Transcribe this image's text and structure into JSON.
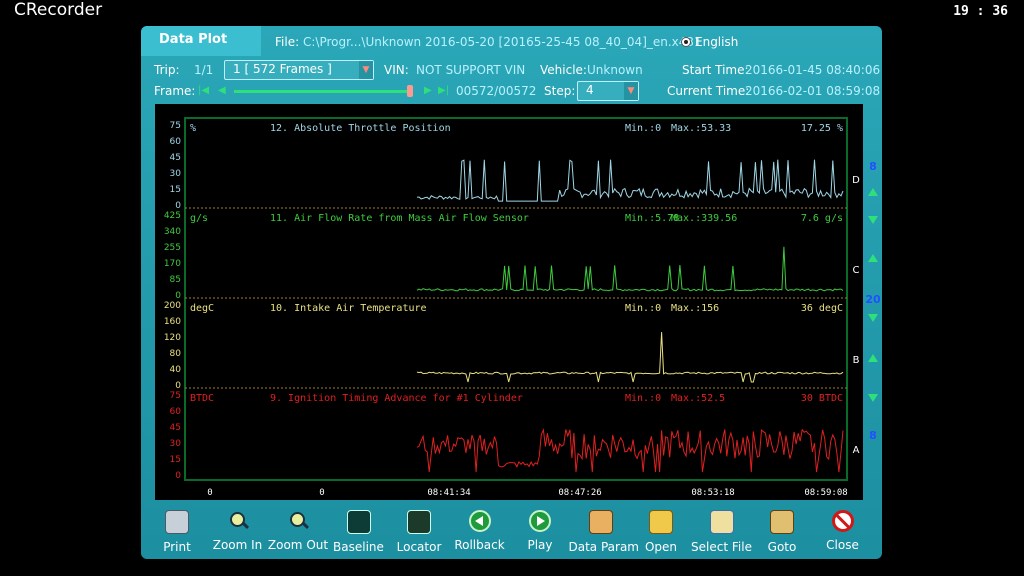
{
  "app": {
    "title": "CRecorder",
    "clock": "19 : 36"
  },
  "header": {
    "title": "Data Plot",
    "file_label": "File:",
    "file_value": "C:\\Progr...\\Unknown 2016-05-20 [20165-25-45 08_40_04]_en.x431",
    "language": "English"
  },
  "info": {
    "trip_label": "Trip:",
    "trip_value": "1/1",
    "trip_select": "1  [   572 Frames ]",
    "vin_label": "VIN:",
    "vin_value": "NOT SUPPORT VIN",
    "vehicle_label": "Vehicle:",
    "vehicle_value": "Unknown",
    "start_label": "Start Time:",
    "start_value": "20166-01-45 08:40:06",
    "frame_label": "Frame:",
    "frame_value": "00572/00572",
    "step_label": "Step:",
    "step_value": "4",
    "current_label": "Current Time:",
    "current_value": "20166-02-01 08:59:08",
    "frame_progress": 1.0
  },
  "chart_data": [
    {
      "type": "line",
      "unit": "%",
      "title": "12. Absolute Throttle Position",
      "min": "Min.:0",
      "max": "Max.:53.33",
      "current": "17.25  %",
      "yticks": [
        "75",
        "60",
        "45",
        "30",
        "15",
        "0"
      ],
      "ylim": [
        0,
        75
      ],
      "color": "#9fd6e6",
      "channel": "D",
      "values": [
        0,
        0,
        0,
        0,
        0,
        0,
        0,
        0,
        0,
        0,
        0,
        0,
        0,
        0,
        0,
        0,
        0,
        0,
        0,
        0,
        0,
        0,
        0,
        0,
        0,
        0,
        0,
        0,
        0,
        0,
        0,
        0,
        0,
        0,
        0,
        0,
        0,
        0,
        0,
        0,
        0,
        0,
        0,
        0,
        0,
        0,
        0,
        0,
        0,
        0,
        0,
        0,
        0,
        0,
        0,
        0,
        0,
        0,
        0,
        0,
        0,
        0,
        0,
        0,
        0,
        0,
        0,
        0,
        0,
        0,
        0,
        0,
        0,
        0,
        0,
        0,
        0,
        0,
        0,
        0,
        0,
        0,
        0,
        0,
        0,
        0,
        0,
        0,
        0,
        0,
        0,
        0,
        0,
        0,
        0,
        0,
        0,
        0,
        0,
        0,
        0,
        0,
        0,
        0,
        0,
        0,
        0,
        0,
        0,
        0,
        0,
        0,
        0,
        0,
        0,
        0,
        0,
        0,
        0,
        0,
        0,
        0,
        0,
        0,
        0,
        0,
        0,
        0,
        0,
        0,
        0,
        0,
        0,
        0,
        0,
        0,
        0,
        0,
        0,
        0,
        0,
        0,
        0,
        0,
        0,
        0,
        0,
        0,
        0,
        0,
        0,
        0,
        0,
        0,
        0,
        0,
        0,
        0,
        0,
        0,
        0,
        0,
        0,
        0,
        0,
        0,
        0,
        0,
        0,
        0,
        0,
        0,
        0,
        0,
        0,
        0,
        0,
        0,
        0,
        0,
        0,
        0,
        0,
        0,
        0,
        0,
        0,
        0,
        0,
        0,
        0,
        0,
        0,
        0,
        0,
        0,
        0,
        0,
        0,
        0,
        0,
        0,
        0,
        0,
        0,
        0,
        0,
        0,
        0,
        0,
        0,
        0,
        0,
        0,
        0,
        0,
        0,
        0,
        0,
        0,
        0,
        0,
        0,
        0,
        0,
        0,
        0,
        0,
        0,
        0,
        0,
        0,
        0,
        0,
        0,
        0,
        0,
        0,
        0,
        0,
        0,
        0,
        0,
        0,
        0,
        0,
        0,
        0,
        0,
        0,
        0,
        0,
        0,
        0,
        0,
        0,
        0,
        0,
        0,
        0,
        0,
        0,
        0,
        0,
        0,
        0,
        0,
        0,
        0,
        0,
        0,
        0,
        0,
        0,
        0,
        0,
        0,
        0,
        0,
        0,
        0,
        0,
        0,
        0,
        0,
        0,
        0,
        0,
        0,
        0,
        0,
        0,
        0,
        0,
        0,
        0,
        0,
        0,
        0,
        0,
        0,
        0,
        0,
        0,
        0,
        0,
        0,
        0,
        0,
        0,
        0,
        0,
        0,
        0,
        0,
        0,
        0,
        0,
        0,
        0,
        0,
        0,
        0,
        0,
        0,
        0,
        0,
        0,
        0,
        0,
        0,
        0,
        0,
        0,
        0,
        0,
        0,
        0,
        0,
        0,
        0,
        0,
        0,
        0,
        0,
        0,
        0,
        0,
        0,
        0,
        0,
        0,
        0,
        0,
        0,
        0,
        0,
        0,
        0,
        0,
        0,
        0,
        0,
        0,
        0,
        0,
        0,
        0,
        0,
        0,
        0,
        0,
        0,
        0,
        0,
        0,
        0,
        0,
        0,
        0,
        0,
        0,
        0,
        0,
        0,
        0,
        0,
        0,
        0,
        0,
        0,
        0,
        0,
        0,
        0,
        0,
        0,
        0,
        0,
        0,
        0,
        0,
        0,
        0,
        0,
        0,
        0,
        0,
        0,
        0,
        0,
        0,
        0,
        0,
        0,
        0,
        0,
        0,
        0,
        0,
        0,
        0,
        0,
        0,
        0,
        0,
        0,
        0,
        0,
        0,
        0,
        0,
        0,
        0,
        0,
        0,
        0,
        0,
        0,
        0,
        0,
        0,
        0,
        0,
        0,
        0,
        0,
        0,
        0,
        0,
        0,
        0,
        0,
        0,
        0,
        0,
        0,
        0,
        0,
        0,
        0,
        0,
        0,
        0,
        0,
        0,
        0,
        0,
        0,
        0,
        0,
        0,
        0,
        0,
        0,
        0,
        0,
        0,
        0,
        0,
        0,
        0,
        0,
        0,
        0,
        0,
        0,
        0,
        0,
        0,
        0,
        0,
        0,
        0,
        0,
        0,
        0,
        0,
        0,
        0,
        0,
        0,
        0,
        0,
        0,
        0,
        0,
        0,
        0,
        0,
        0,
        0,
        0,
        0,
        0,
        0,
        0,
        0,
        0,
        0,
        0,
        0,
        0,
        0,
        0,
        0,
        0,
        0,
        0,
        0,
        0,
        0,
        0,
        0,
        0,
        0,
        0,
        0,
        0,
        0,
        0,
        0,
        0,
        0,
        0,
        0,
        0,
        0,
        0,
        0,
        0,
        0,
        0,
        0,
        0,
        0,
        0,
        0,
        0,
        0,
        0,
        0,
        0,
        0,
        0,
        0,
        0,
        0,
        0,
        0,
        0,
        0,
        0,
        0,
        0,
        0,
        0,
        0,
        0,
        0,
        0,
        0,
        0,
        0,
        0,
        0,
        0,
        0,
        0,
        0,
        0,
        0,
        0,
        0,
        0,
        0,
        0,
        0,
        0,
        0,
        0,
        0,
        0,
        0,
        0,
        0,
        0,
        0,
        0,
        0,
        0,
        0
      ]
    },
    {
      "type": "line",
      "unit": "g/s",
      "title": "11. Air Flow Rate from Mass Air Flow Sensor",
      "min": "Min.:5.78",
      "max": "Max.:339.56",
      "current": "7.6  g/s",
      "yticks": [
        "425",
        "340",
        "255",
        "170",
        "85",
        "0"
      ],
      "ylim": [
        0,
        425
      ],
      "color": "#3ecb3e",
      "channel": "C",
      "values": []
    },
    {
      "type": "line",
      "unit": "degC",
      "title": "10. Intake Air Temperature",
      "min": "Min.:0",
      "max": "Max.:156",
      "current": "36  degC",
      "yticks": [
        "200",
        "160",
        "120",
        "80",
        "40",
        "0"
      ],
      "ylim": [
        0,
        200
      ],
      "color": "#e8e080",
      "channel": "B",
      "values": []
    },
    {
      "type": "line",
      "unit": "BTDC",
      "title": "9. Ignition Timing Advance for #1 Cylinder",
      "min": "Min.:0",
      "max": "Max.:52.5",
      "current": "30  BTDC",
      "yticks": [
        "75",
        "60",
        "45",
        "30",
        "15",
        "0"
      ],
      "ylim": [
        0,
        75
      ],
      "color": "#e02020",
      "channel": "A",
      "values": []
    }
  ],
  "xaxis": {
    "ticks": [
      "0",
      "0",
      "08:41:34",
      "08:47:26",
      "08:53:18",
      "08:59:08"
    ]
  },
  "side": {
    "top": "8",
    "mid": "20",
    "bottom": "8"
  },
  "toolbar": [
    {
      "label": "Print",
      "icon": "print-icon",
      "cls": "ic-print"
    },
    {
      "label": "Zoom In",
      "icon": "zoom-in-icon",
      "cls": "ic-zoomin"
    },
    {
      "label": "Zoom Out",
      "icon": "zoom-out-icon",
      "cls": "ic-zoomout"
    },
    {
      "label": "Baseline",
      "icon": "baseline-icon",
      "cls": "ic-baseline"
    },
    {
      "label": "Locator",
      "icon": "locator-icon",
      "cls": "ic-locator"
    },
    {
      "label": "Rollback",
      "icon": "rollback-icon",
      "cls": "ic-rollback"
    },
    {
      "label": "Play",
      "icon": "play-icon",
      "cls": "ic-play"
    },
    {
      "label": "Data Param",
      "icon": "data-param-icon",
      "cls": "ic-dataparam"
    },
    {
      "label": "Open",
      "icon": "folder-open-icon",
      "cls": "ic-open"
    },
    {
      "label": "Select File",
      "icon": "select-file-icon",
      "cls": "ic-selectfile"
    },
    {
      "label": "Goto",
      "icon": "goto-icon",
      "cls": "ic-goto"
    },
    {
      "label": "Close",
      "icon": "close-icon",
      "cls": "ic-close"
    }
  ]
}
